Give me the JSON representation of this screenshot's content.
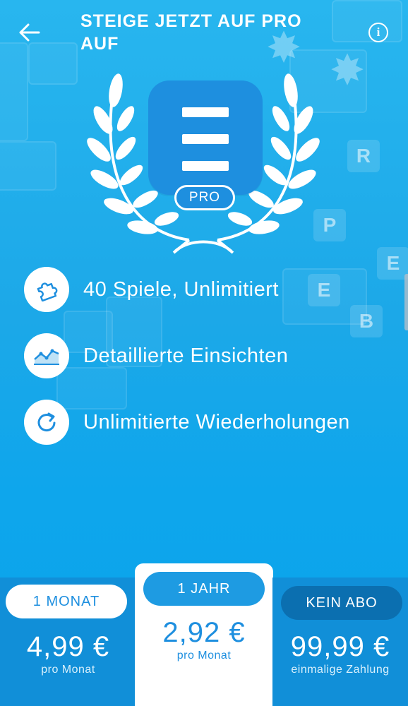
{
  "header": {
    "title": "STEIGE JETZT AUF PRO AUF",
    "back_icon": "arrow-left-icon",
    "info_icon": "info-icon",
    "info_glyph": "i"
  },
  "app_badge": {
    "pro_label": "PRO"
  },
  "features": [
    {
      "icon": "puzzle-icon",
      "label": "40 Spiele, Unlimitiert"
    },
    {
      "icon": "chart-icon",
      "label": "Detaillierte Einsichten"
    },
    {
      "icon": "refresh-icon",
      "label": "Unlimitierte Wiederholungen"
    }
  ],
  "plans": [
    {
      "name": "1 MONAT",
      "price": "4,99 €",
      "per": "pro Monat"
    },
    {
      "name": "1 JAHR",
      "price": "2,92 €",
      "per": "pro Monat",
      "selected": true
    },
    {
      "name": "KEIN ABO",
      "price": "99,99 €",
      "per": "einmalige Zahlung"
    }
  ],
  "colors": {
    "background": "#1ca8e8",
    "accent_dark": "#118fd8",
    "icon_blue": "#1e8fdf",
    "white": "#ffffff"
  }
}
